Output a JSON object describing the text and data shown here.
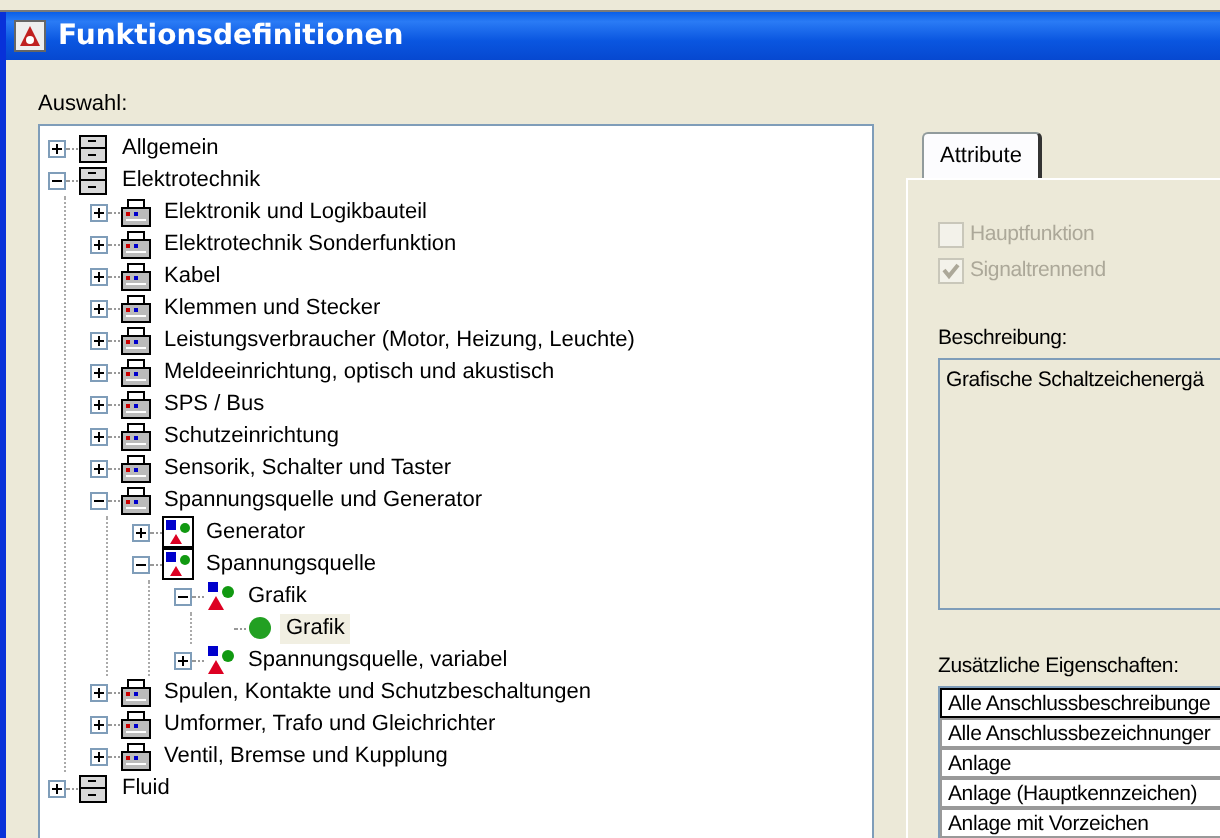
{
  "window": {
    "title": "Funktionsdefinitionen"
  },
  "tree": {
    "label": "Auswahl:",
    "items": [
      {
        "label": "Allgemein",
        "kind": "cabinet",
        "expanded": false,
        "selected": false
      },
      {
        "label": "Elektrotechnik",
        "kind": "cabinet",
        "expanded": true,
        "selected": false,
        "children": [
          {
            "label": "Elektronik und Logikbauteil",
            "kind": "device",
            "expanded": false,
            "selected": false
          },
          {
            "label": "Elektrotechnik Sonderfunktion",
            "kind": "device",
            "expanded": false,
            "selected": false
          },
          {
            "label": "Kabel",
            "kind": "device",
            "expanded": false,
            "selected": false
          },
          {
            "label": "Klemmen und Stecker",
            "kind": "device",
            "expanded": false,
            "selected": false
          },
          {
            "label": "Leistungsverbraucher (Motor, Heizung, Leuchte)",
            "kind": "device",
            "expanded": false,
            "selected": false
          },
          {
            "label": "Meldeeinrichtung, optisch und akustisch",
            "kind": "device",
            "expanded": false,
            "selected": false
          },
          {
            "label": "SPS / Bus",
            "kind": "device",
            "expanded": false,
            "selected": false
          },
          {
            "label": "Schutzeinrichtung",
            "kind": "device",
            "expanded": false,
            "selected": false
          },
          {
            "label": "Sensorik, Schalter und Taster",
            "kind": "device",
            "expanded": false,
            "selected": false
          },
          {
            "label": "Spannungsquelle und Generator",
            "kind": "device",
            "expanded": true,
            "selected": false,
            "children": [
              {
                "label": "Generator",
                "kind": "framed-symbol",
                "expanded": false,
                "selected": false
              },
              {
                "label": "Spannungsquelle",
                "kind": "framed-symbol",
                "expanded": true,
                "selected": false,
                "children": [
                  {
                    "label": "Grafik",
                    "kind": "symbol",
                    "expanded": true,
                    "selected": false,
                    "children": [
                      {
                        "label": "Grafik",
                        "kind": "dot",
                        "selected": true
                      }
                    ]
                  },
                  {
                    "label": "Spannungsquelle, variabel",
                    "kind": "symbol",
                    "expanded": false,
                    "selected": false
                  }
                ]
              }
            ]
          },
          {
            "label": "Spulen, Kontakte und Schutzbeschaltungen",
            "kind": "device",
            "expanded": false,
            "selected": false
          },
          {
            "label": "Umformer, Trafo und Gleichrichter",
            "kind": "device",
            "expanded": false,
            "selected": false
          },
          {
            "label": "Ventil, Bremse und Kupplung",
            "kind": "device",
            "expanded": false,
            "selected": false
          }
        ]
      },
      {
        "label": "Fluid",
        "kind": "cabinet",
        "expanded": false,
        "selected": false
      }
    ]
  },
  "tabs": [
    {
      "label": "Attribute",
      "selected": true
    }
  ],
  "options": [
    {
      "label": "Hauptfunktion",
      "checked": false,
      "disabled": true
    },
    {
      "label": "Signaltrennend",
      "checked": true,
      "disabled": true
    }
  ],
  "description": {
    "label": "Beschreibung:",
    "value": "Grafische Schaltzeichenergä"
  },
  "properties": {
    "label": "Zusätzliche Eigenschaften:",
    "items": [
      {
        "label": "Alle Anschlussbeschreibunge",
        "selected": true
      },
      {
        "label": "Alle Anschlussbezeichnunger",
        "selected": false
      },
      {
        "label": "Anlage",
        "selected": false
      },
      {
        "label": "Anlage (Hauptkennzeichen)",
        "selected": false
      },
      {
        "label": "Anlage mit Vorzeichen",
        "selected": false
      }
    ]
  }
}
